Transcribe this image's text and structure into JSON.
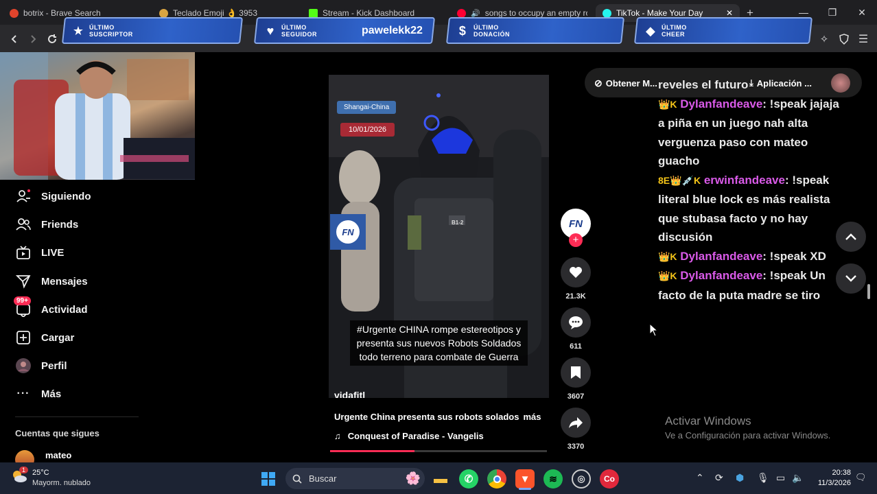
{
  "browser": {
    "tabs": [
      {
        "title": "botrix - Brave Search",
        "favicon_color": "#e0442c"
      },
      {
        "title": "Teclado Emoji 👌 3953",
        "favicon_color": "#d9a441"
      },
      {
        "title": "Stream - Kick Dashboard",
        "favicon_color": "#53fc18"
      },
      {
        "title": "songs to occupy an empty roo",
        "favicon_color": "#ff0033"
      },
      {
        "title": "TikTok - Make Your Day",
        "favicon_color": "#25f4ee"
      }
    ],
    "new_tab": "+",
    "window_controls": {
      "minimize": "—",
      "maximize": "❐",
      "close": "✕"
    }
  },
  "overlay": {
    "widgets": [
      {
        "label_top": "ÚLTIMO",
        "label_bottom": "SUSCRIPTOR",
        "value": "",
        "icon": "star-icon"
      },
      {
        "label_top": "ÚLTIMO",
        "label_bottom": "SEGUIDOR",
        "value": "pawelekk22",
        "icon": "heart-icon"
      },
      {
        "label_top": "ÚLTIMO",
        "label_bottom": "DONACIÓN",
        "value": "",
        "icon": "dollar-icon"
      },
      {
        "label_top": "ÚLTIMO",
        "label_bottom": "CHEER",
        "value": "",
        "icon": "diamond-icon"
      }
    ]
  },
  "sidebar": {
    "items": [
      {
        "label": "Siguiendo",
        "icon": "following-icon"
      },
      {
        "label": "Friends",
        "icon": "friends-icon"
      },
      {
        "label": "LIVE",
        "icon": "live-icon"
      },
      {
        "label": "Mensajes",
        "icon": "messages-icon"
      },
      {
        "label": "Actividad",
        "icon": "activity-icon",
        "badge": "99+"
      },
      {
        "label": "Cargar",
        "icon": "upload-icon"
      },
      {
        "label": "Perfil",
        "icon": "profile-icon"
      },
      {
        "label": "Más",
        "icon": "more-icon"
      }
    ],
    "following_heading": "Cuentas que sigues",
    "following_accounts": [
      "mateo"
    ]
  },
  "topbar": {
    "get_coins": "Obtener M...",
    "app_button": "Aplicación ..."
  },
  "video": {
    "location_tag": "Shangai-China",
    "date_tag": "10/01/2026",
    "caption_overlay": "#Urgente CHINA rompe estereotipos y presenta sus nuevos Robots Soldados todo terreno para combate de Guerra",
    "helmet_tag": "B1-2",
    "author": "vidafitl",
    "description": "Urgente China presenta  sus robots solados",
    "more_link": "más",
    "music": "Conquest of Paradise - Vangelis",
    "channel_logo": "FN",
    "progress": 0.39
  },
  "actions": {
    "likes": "21.3K",
    "comments": "611",
    "saves": "3607",
    "shares": "3370"
  },
  "chat": {
    "partial_line": "reveles el futuro",
    "messages": [
      {
        "badges": "👑K",
        "user": "Dylanfandeave",
        "text": ": !speak jajaja a piña en un juego nah alta verguenza paso con mateo guacho"
      },
      {
        "badges": "8E👑💉K",
        "user": "erwinfandeave",
        "text": ": !speak literal blue lock es más realista que stubasa facto y no hay discusión"
      },
      {
        "badges": "👑K",
        "user": "Dylanfandeave",
        "text": ": !speak XD"
      },
      {
        "badges": "👑K",
        "user": "Dylanfandeave",
        "text": ": !speak Un facto de la puta madre se tiro"
      }
    ]
  },
  "windows_watermark": {
    "title": "Activar Windows",
    "subtitle": "Ve a Configuración para activar Windows."
  },
  "taskbar": {
    "weather_temp": "25°C",
    "weather_desc": "Mayorm. nublado",
    "weather_badge": "1",
    "search_placeholder": "Buscar",
    "time": "20:38",
    "date": "11/3/2026"
  }
}
